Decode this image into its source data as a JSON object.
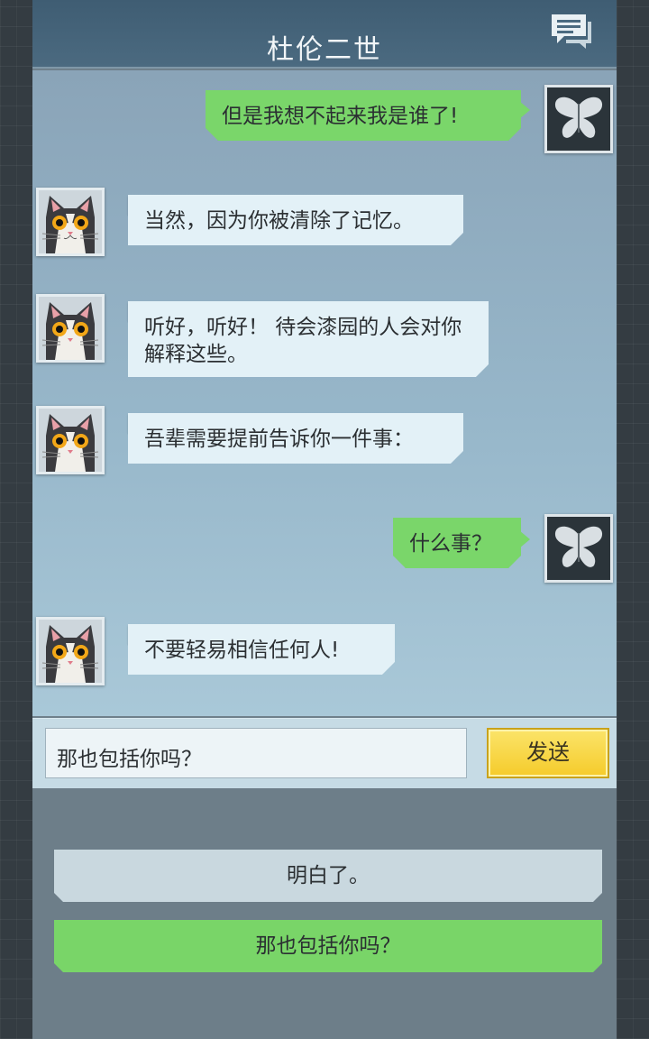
{
  "header": {
    "title": "杜伦二世",
    "icon": "chat-bubbles-icon"
  },
  "messages": [
    {
      "sender": "player",
      "text": "但是我想不起来我是谁了!"
    },
    {
      "sender": "npc",
      "text": "当然，因为你被清除了记忆。"
    },
    {
      "sender": "npc",
      "text": "听好，听好！ 待会漆园的人会对你解释这些。"
    },
    {
      "sender": "npc",
      "text": "吾辈需要提前告诉你一件事："
    },
    {
      "sender": "player",
      "text": "什么事？"
    },
    {
      "sender": "npc",
      "text": "不要轻易相信任何人!"
    }
  ],
  "avatars": {
    "npc": "cat-avatar-icon",
    "player": "butterfly-avatar-icon"
  },
  "input": {
    "value": "那也包括你吗？",
    "send_label": "发送"
  },
  "choices": [
    {
      "label": "明白了。"
    },
    {
      "label": "那也包括你吗？"
    }
  ],
  "colors": {
    "header": "#4b6a80",
    "npc_bubble": "#e3f1f7",
    "player_bubble": "#7ad66a",
    "send_button": "#f5cb2a"
  }
}
